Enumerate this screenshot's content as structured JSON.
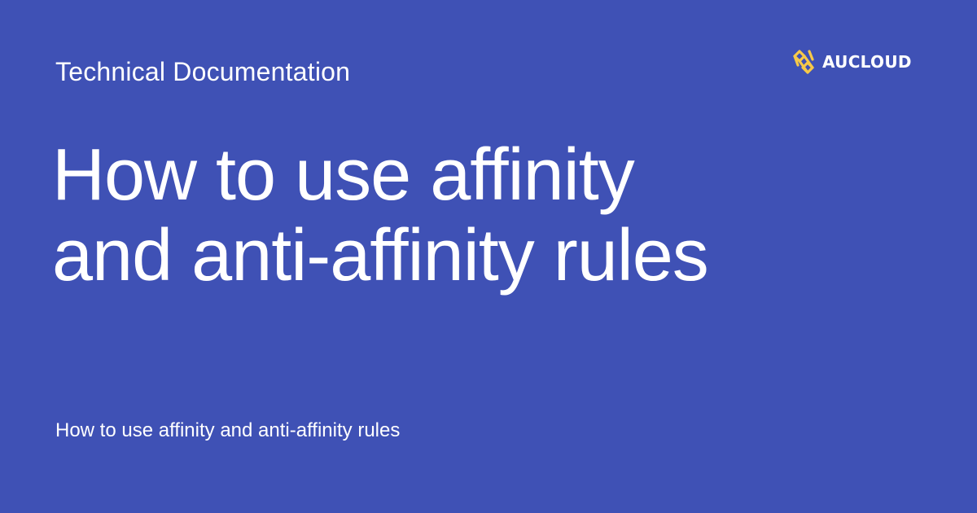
{
  "header": {
    "eyebrow": "Technical Documentation"
  },
  "brand": {
    "name": "AUCLOUD",
    "icon": "aucloud-logo-icon",
    "accent_color": "#f7c948"
  },
  "main": {
    "title": "How to use affinity and anti-affinity rules",
    "subtitle": "How to use affinity and anti-affinity rules"
  },
  "colors": {
    "background": "#3f51b5",
    "text": "#ffffff"
  }
}
